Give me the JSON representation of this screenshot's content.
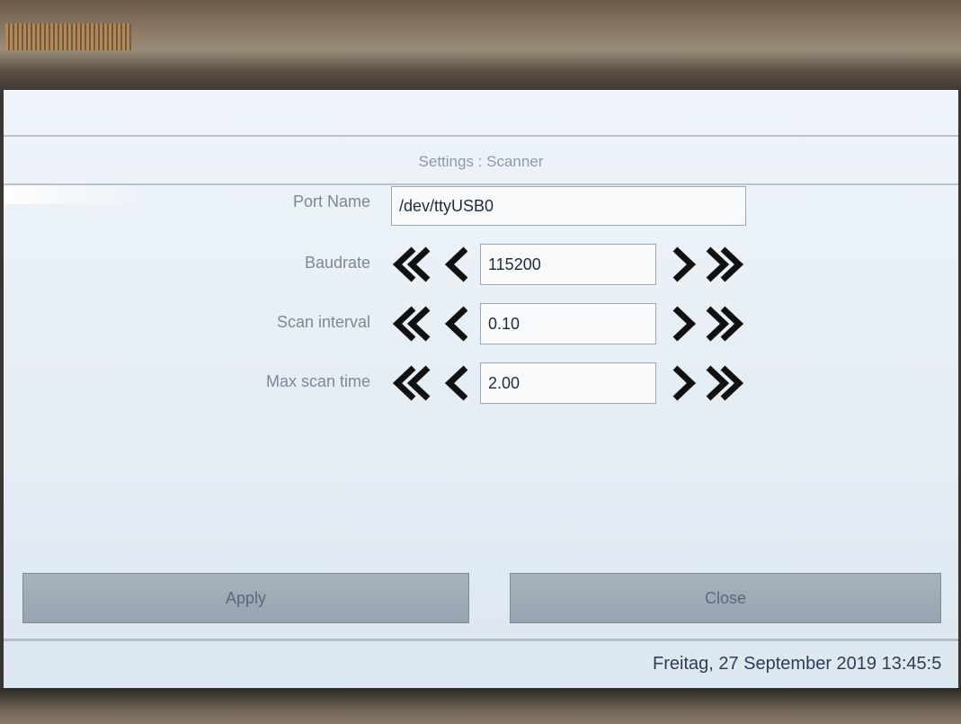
{
  "window": {
    "title": "Settings : Scanner"
  },
  "fields": {
    "port_name": {
      "label": "Port Name",
      "value": "/dev/ttyUSB0"
    },
    "baudrate": {
      "label": "Baudrate",
      "value": "115200"
    },
    "scan_interval": {
      "label": "Scan interval",
      "value": "0.10"
    },
    "max_scan_time": {
      "label": "Max scan time",
      "value": "2.00"
    }
  },
  "icons": {
    "decrement_large": "double-chevron-left-icon",
    "decrement_small": "chevron-left-icon",
    "increment_small": "chevron-right-icon",
    "increment_large": "double-chevron-right-icon"
  },
  "buttons": {
    "apply": "Apply",
    "close": "Close"
  },
  "status_bar": {
    "datetime": "Freitag, 27 September 2019 13:45:5"
  },
  "colors": {
    "screen_bg": "#e6eef5",
    "button_bg": "#9ea9b6",
    "arrow": "#111111",
    "status_text": "#2d3e56"
  }
}
